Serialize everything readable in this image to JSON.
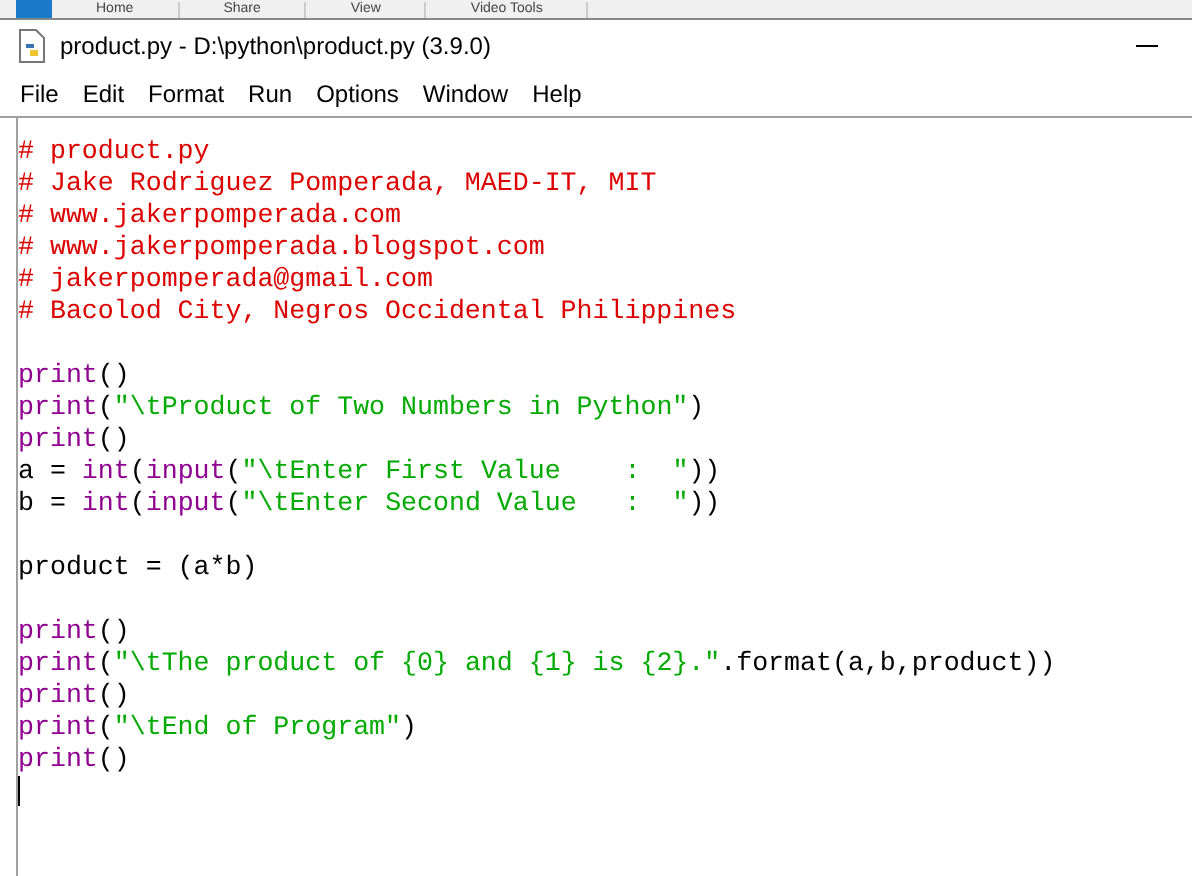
{
  "background_ribbon": [
    "Home",
    "Share",
    "View",
    "Video Tools"
  ],
  "window": {
    "title": "product.py - D:\\python\\product.py (3.9.0)"
  },
  "menu": [
    "File",
    "Edit",
    "Format",
    "Run",
    "Options",
    "Window",
    "Help"
  ],
  "editor": {
    "lines": [
      {
        "kind": "code",
        "tokens": [
          {
            "kind": "comment",
            "text": "# product.py"
          }
        ]
      },
      {
        "kind": "code",
        "tokens": [
          {
            "kind": "comment",
            "text": "# Jake Rodriguez Pomperada, MAED-IT, MIT"
          }
        ]
      },
      {
        "kind": "code",
        "tokens": [
          {
            "kind": "comment",
            "text": "# www.jakerpomperada.com"
          }
        ]
      },
      {
        "kind": "code",
        "tokens": [
          {
            "kind": "comment",
            "text": "# www.jakerpomperada.blogspot.com"
          }
        ]
      },
      {
        "kind": "code",
        "tokens": [
          {
            "kind": "comment",
            "text": "# jakerpomperada@gmail.com"
          }
        ]
      },
      {
        "kind": "code",
        "tokens": [
          {
            "kind": "comment",
            "text": "# Bacolod City, Negros Occidental Philippines"
          }
        ]
      },
      {
        "kind": "blank"
      },
      {
        "kind": "code",
        "tokens": [
          {
            "kind": "builtin",
            "text": "print"
          },
          {
            "kind": "plain",
            "text": "()"
          }
        ]
      },
      {
        "kind": "code",
        "tokens": [
          {
            "kind": "builtin",
            "text": "print"
          },
          {
            "kind": "plain",
            "text": "("
          },
          {
            "kind": "string",
            "text": "\"\\tProduct of Two Numbers in Python\""
          },
          {
            "kind": "plain",
            "text": ")"
          }
        ]
      },
      {
        "kind": "code",
        "tokens": [
          {
            "kind": "builtin",
            "text": "print"
          },
          {
            "kind": "plain",
            "text": "()"
          }
        ]
      },
      {
        "kind": "code",
        "tokens": [
          {
            "kind": "plain",
            "text": "a = "
          },
          {
            "kind": "builtin",
            "text": "int"
          },
          {
            "kind": "plain",
            "text": "("
          },
          {
            "kind": "builtin",
            "text": "input"
          },
          {
            "kind": "plain",
            "text": "("
          },
          {
            "kind": "string",
            "text": "\"\\tEnter First Value    :  \""
          },
          {
            "kind": "plain",
            "text": "))"
          }
        ]
      },
      {
        "kind": "code",
        "tokens": [
          {
            "kind": "plain",
            "text": "b = "
          },
          {
            "kind": "builtin",
            "text": "int"
          },
          {
            "kind": "plain",
            "text": "("
          },
          {
            "kind": "builtin",
            "text": "input"
          },
          {
            "kind": "plain",
            "text": "("
          },
          {
            "kind": "string",
            "text": "\"\\tEnter Second Value   :  \""
          },
          {
            "kind": "plain",
            "text": "))"
          }
        ]
      },
      {
        "kind": "blank"
      },
      {
        "kind": "code",
        "tokens": [
          {
            "kind": "plain",
            "text": "product = (a*b)"
          }
        ]
      },
      {
        "kind": "blank"
      },
      {
        "kind": "code",
        "tokens": [
          {
            "kind": "builtin",
            "text": "print"
          },
          {
            "kind": "plain",
            "text": "()"
          }
        ]
      },
      {
        "kind": "code",
        "tokens": [
          {
            "kind": "builtin",
            "text": "print"
          },
          {
            "kind": "plain",
            "text": "("
          },
          {
            "kind": "string",
            "text": "\"\\tThe product of {0} and {1} is {2}.\""
          },
          {
            "kind": "plain",
            "text": ".format(a,b,product))"
          }
        ]
      },
      {
        "kind": "code",
        "tokens": [
          {
            "kind": "builtin",
            "text": "print"
          },
          {
            "kind": "plain",
            "text": "()"
          }
        ]
      },
      {
        "kind": "code",
        "tokens": [
          {
            "kind": "builtin",
            "text": "print"
          },
          {
            "kind": "plain",
            "text": "("
          },
          {
            "kind": "string",
            "text": "\"\\tEnd of Program\""
          },
          {
            "kind": "plain",
            "text": ")"
          }
        ]
      },
      {
        "kind": "code",
        "tokens": [
          {
            "kind": "builtin",
            "text": "print"
          },
          {
            "kind": "plain",
            "text": "()"
          }
        ]
      },
      {
        "kind": "cursor"
      }
    ]
  }
}
